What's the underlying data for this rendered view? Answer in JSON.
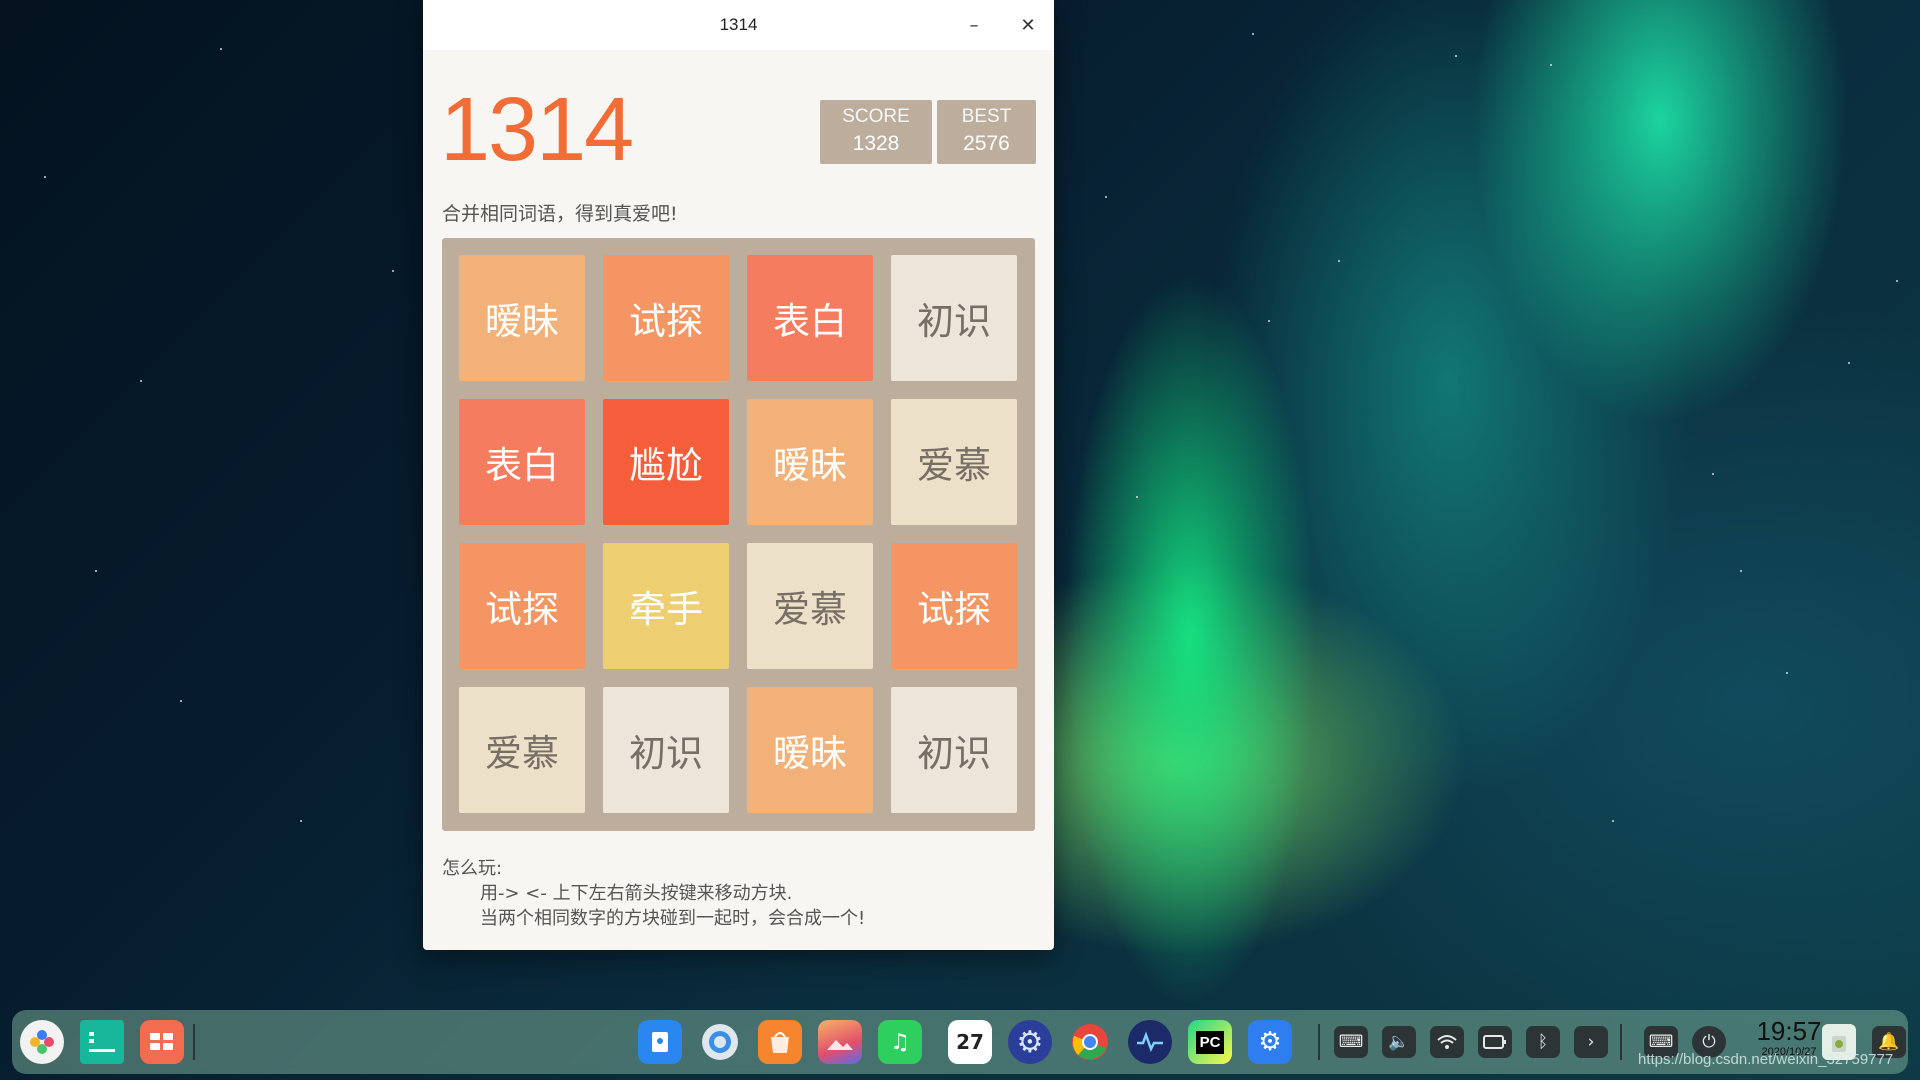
{
  "window": {
    "title": "1314",
    "minimize_glyph": "–",
    "close_glyph": "✕"
  },
  "game": {
    "title": "1314",
    "score": {
      "label": "SCORE",
      "value": "1328"
    },
    "best": {
      "label": "BEST",
      "value": "2576"
    },
    "tagline": "合并相同词语，得到真爱吧!",
    "tiles": [
      [
        "暧昧",
        "试探",
        "表白",
        "初识"
      ],
      [
        "表白",
        "尴尬",
        "暧昧",
        "爱慕"
      ],
      [
        "试探",
        "牵手",
        "爱慕",
        "试探"
      ],
      [
        "爱慕",
        "初识",
        "暧昧",
        "初识"
      ]
    ],
    "tile_colors": {
      "初识": {
        "bg": "#ede4da",
        "fg": "#776e65"
      },
      "爱慕": {
        "bg": "#ede0c8",
        "fg": "#776e65"
      },
      "暧昧": {
        "bg": "#f2b179",
        "fg": "#ffffff"
      },
      "试探": {
        "bg": "#f59563",
        "fg": "#ffffff"
      },
      "表白": {
        "bg": "#f67c5f",
        "fg": "#ffffff"
      },
      "尴尬": {
        "bg": "#f65e3b",
        "fg": "#ffffff"
      },
      "牵手": {
        "bg": "#edcf72",
        "fg": "#ffffff"
      }
    },
    "howto": {
      "heading": "怎么玩:",
      "line1": "用-> <- 上下左右箭头按键来移动方块.",
      "line2": "当两个相同数字的方块碰到一起时，会合成一个!"
    }
  },
  "taskbar": {
    "clock": {
      "time": "19:57",
      "date": "2020/10/27"
    },
    "calendar_icon_day": "27",
    "pycharm_label": "PC"
  },
  "watermark": "https://blog.csdn.net/weixin_32759777"
}
